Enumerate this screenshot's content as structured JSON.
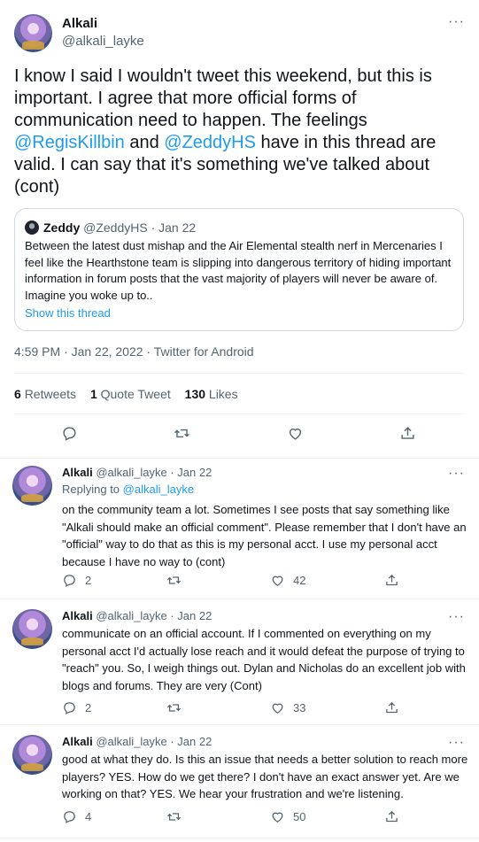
{
  "main_tweet": {
    "author_name": "Alkali",
    "author_handle": "@alkali_layke",
    "text_parts": {
      "p1": "I know I said I wouldn't tweet this weekend, but this is important.  I agree that more official forms of communication need to happen. The feelings ",
      "mention1": "@RegisKillbin",
      "p2": " and ",
      "mention2": "@ZeddyHS",
      "p3": " have in this thread are valid. I can say that it's something we've talked about (cont)"
    },
    "quote": {
      "name": "Zeddy",
      "handle_date": "@ZeddyHS · Jan 22",
      "text": "Between the latest dust mishap and the Air Elemental stealth nerf in Mercenaries I feel like the Hearthstone team is slipping into dangerous territory of hiding important information in forum posts that the vast majority of players will never be aware of. Imagine you woke up to..",
      "show_thread": "Show this thread"
    },
    "meta": "4:59 PM · Jan 22, 2022 · Twitter for Android",
    "stats": {
      "retweets_count": "6",
      "retweets_label": "Retweets",
      "quotes_count": "1",
      "quotes_label": "Quote Tweet",
      "likes_count": "130",
      "likes_label": "Likes"
    },
    "more_label": "···"
  },
  "replies": [
    {
      "name": "Alkali",
      "handle_date": "@alkali_layke · Jan 22",
      "replying_prefix": "Replying to ",
      "replying_handle": "@alkali_layke",
      "text": "on the community team a lot. Sometimes I see posts that say something like \"Alkali should make an official comment\". Please remember that I don't have an \"official\" way to do that as this is my personal acct. I use my personal acct because I have no way to (cont)",
      "replies": "2",
      "retweets": "",
      "likes": "42",
      "more_label": "···"
    },
    {
      "name": "Alkali",
      "handle_date": "@alkali_layke · Jan 22",
      "text": "communicate on an official account. If I commented on everything on my personal acct I'd actually lose reach and it would defeat the purpose of trying to \"reach\" you.  So, I weigh things out.  Dylan and Nicholas do an excellent job with blogs and forums. They are very (Cont)",
      "replies": "2",
      "retweets": "",
      "likes": "33",
      "more_label": "···"
    },
    {
      "name": "Alkali",
      "handle_date": "@alkali_layke · Jan 22",
      "text": "good at what they do.  Is this an issue that needs a better solution to reach more players? YES. How do we get there? I don't have an exact answer yet. Are we working on that? YES. We hear your frustration and we're listening.",
      "replies": "4",
      "retweets": "",
      "likes": "50",
      "more_label": "···"
    }
  ],
  "colors": {
    "accent": "#1d9bf0",
    "muted": "#536471",
    "border": "#cfd9de",
    "divider": "#eff3f4"
  }
}
